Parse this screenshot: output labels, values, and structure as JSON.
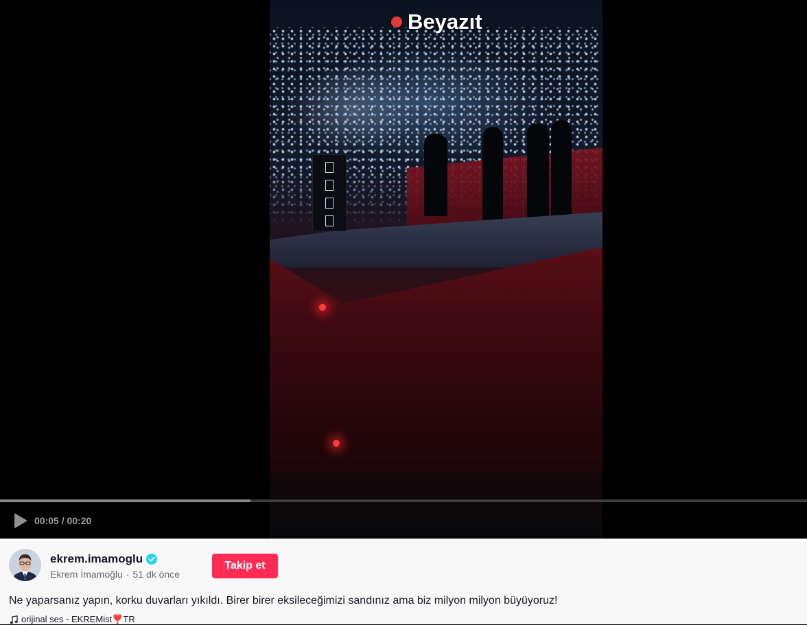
{
  "video": {
    "location_tag": "Beyazıt",
    "current_time": "00:05",
    "duration": "00:20",
    "progress_fraction": 0.31
  },
  "post": {
    "username": "ekrem.imamoglu",
    "verified": true,
    "display_name": "Ekrem İmamoğlu",
    "separator": "·",
    "posted_ago": "51 dk önce",
    "follow_label": "Takip et",
    "caption": "Ne yaparsanız yapın, korku duvarları yıkıldı. Birer birer eksileceğimizi sandınız ama biz milyon milyon büyüyoruz!",
    "music": "orijinal ses - EKREMist❣️TR"
  },
  "icons": {
    "play": "play-icon",
    "verified": "verified-badge-icon",
    "music": "music-note-icon",
    "location": "location-dot-icon"
  },
  "colors": {
    "follow_button": "#fe2c55",
    "verified_badge": "#20d5ec",
    "info_background": "#f8f8f8",
    "player_background": "#000000"
  }
}
